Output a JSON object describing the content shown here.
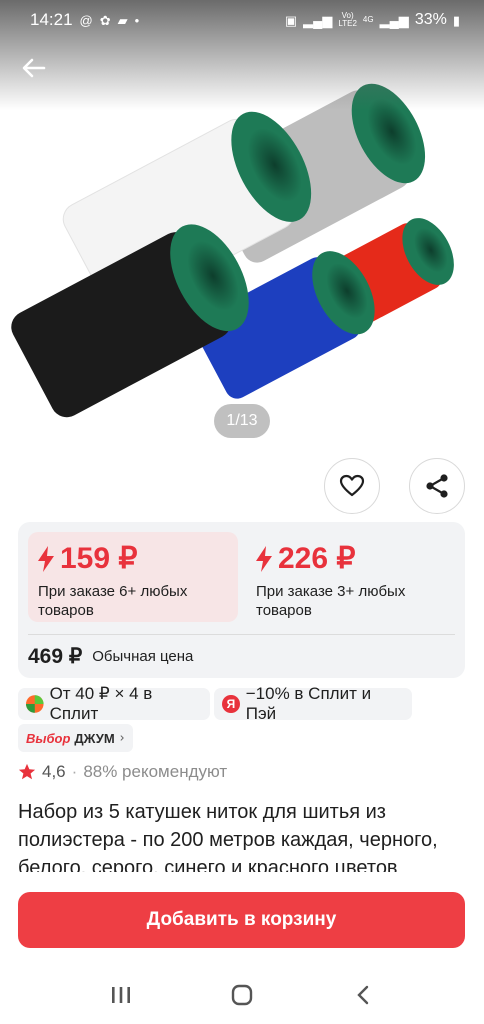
{
  "status_bar": {
    "time": "14:21",
    "battery": "33%",
    "net_top": "Vo)",
    "net_bottom": "LTE2",
    "gen": "4G"
  },
  "gallery": {
    "counter": "1/13",
    "thread_colors": [
      "#1b1b1b",
      "#f4f4f4",
      "#bdbdbd",
      "#1d3fbf",
      "#e52a1a"
    ],
    "core_color": "#1e7a56"
  },
  "prices": {
    "option1": {
      "value": "159 ₽",
      "condition": "При заказе 6+ любых товаров"
    },
    "option2": {
      "value": "226 ₽",
      "condition": "При заказе 3+ любых товаров"
    },
    "regular_value": "469 ₽",
    "regular_label": "Обычная цена"
  },
  "badges": {
    "split": "От 40 ₽ × 4 в Сплит",
    "pay": "−10% в Сплит и Пэй",
    "pay_logo": "Я",
    "choice_label": "Выбор",
    "choice_name": "ДЖУМ"
  },
  "rating": {
    "value": "4,6",
    "recommend": "88% рекомендуют"
  },
  "product": {
    "title": "Набор из 5 катушек ниток для шитья из полиэстера - по 200 метров каждая, черного, белого, серого, синего и красного цветов"
  },
  "cart_button": "Добавить в корзину",
  "colors": {
    "accent": "#ee3e44",
    "price_red": "#e8323c",
    "selected_bg": "#f7e5e6"
  }
}
